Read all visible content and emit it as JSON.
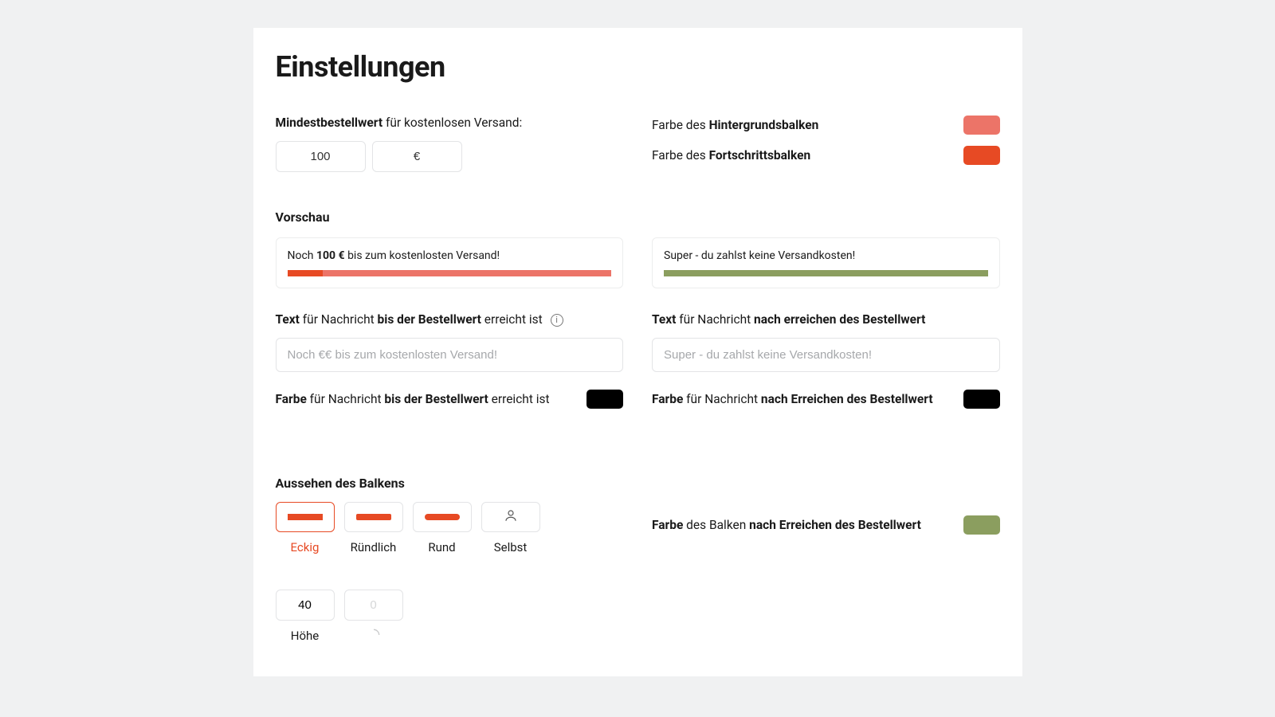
{
  "title": "Einstellungen",
  "minOrder": {
    "label_prefix": "Mindestbestellwert",
    "label_suffix": " für kostenlosen Versand:",
    "value": "100",
    "currency": "€"
  },
  "colors": {
    "bg_prefix": "Farbe des ",
    "bg_strong": "Hintergrundsbalken",
    "bg_hex": "#ec7468",
    "fg_prefix": "Farbe des ",
    "fg_strong": "Fortschrittsbalken",
    "fg_hex": "#e74a24",
    "msgBefore_hex": "#000000",
    "msgAfter_hex": "#000000",
    "barAfter_hex": "#8b9e5f"
  },
  "previewHead": "Vorschau",
  "previewLeft": {
    "pre": "Noch ",
    "strong": "100 €",
    "post": " bis zum kostenlosten Versand!",
    "fillPct": 11
  },
  "previewRight": {
    "text": "Super - du zahlst keine Versandkosten!",
    "fillPct": 100
  },
  "msgBefore": {
    "label_p1": "Text",
    "label_p2": " für Nachricht ",
    "label_p3": "bis der Bestellwert",
    "label_p4": " erreicht ist",
    "placeholder": "Noch €€ bis zum kostenlosten Versand!",
    "color_p1": "Farbe",
    "color_p2": " für Nachricht ",
    "color_p3": "bis der Bestellwert",
    "color_p4": " erreicht ist"
  },
  "msgAfter": {
    "label_p1": "Text",
    "label_p2": " für Nachricht ",
    "label_p3": "nach erreichen des Bestellwert",
    "placeholder": "Super - du zahlst keine Versandkosten!",
    "color_p1": "Farbe",
    "color_p2": " für Nachricht ",
    "color_p3": "nach Erreichen des Bestellwert"
  },
  "appearance": {
    "head": "Aussehen des Balkens",
    "shapes": [
      "Eckig",
      "Ründlich",
      "Rund",
      "Selbst"
    ],
    "selectedIndex": 0,
    "height_value": "40",
    "radius_value": "0",
    "height_label": "Höhe"
  },
  "barAfter": {
    "p1": "Farbe",
    "p2": " des Balken ",
    "p3": "nach Erreichen des Bestellwert"
  }
}
